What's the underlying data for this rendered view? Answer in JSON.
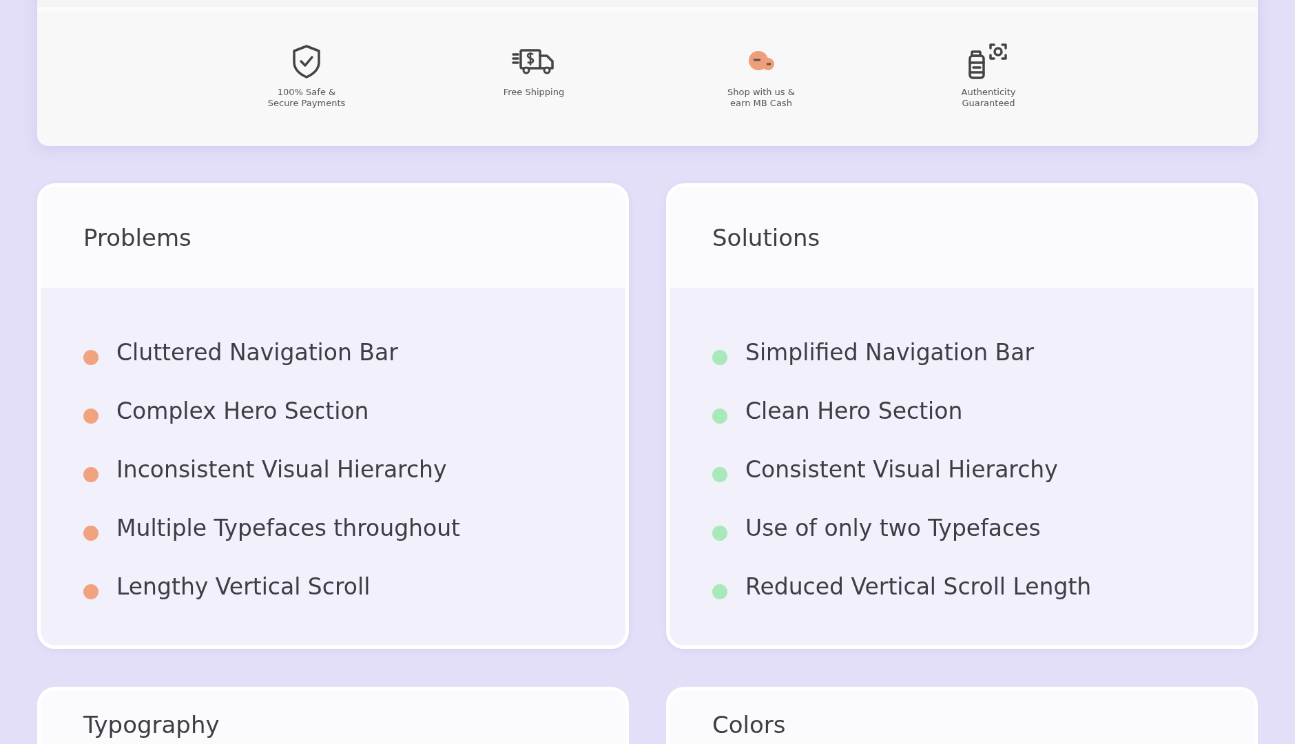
{
  "features": [
    {
      "label": "100% Safe &\nSecure Payments"
    },
    {
      "label": "Free Shipping"
    },
    {
      "label": "Shop with us &\nearn MB Cash"
    },
    {
      "label": "Authenticity\nGuaranteed"
    }
  ],
  "panels": [
    {
      "title": "Problems",
      "items": [
        {
          "text": "Cluttered Navigation Bar",
          "color": "#f0a37e"
        },
        {
          "text": "Complex Hero Section",
          "color": "#f0a37e"
        },
        {
          "text": "Inconsistent Visual Hierarchy",
          "color": "#f0a37e"
        },
        {
          "text": "Multiple Typefaces throughout",
          "color": "#f0a37e"
        },
        {
          "text": "Lengthy Vertical Scroll",
          "color": "#f0a37e"
        }
      ]
    },
    {
      "title": "Solutions",
      "items": [
        {
          "text": "Simplified Navigation Bar",
          "color": "#a9e8b8"
        },
        {
          "text": "Clean Hero Section",
          "color": "#a9e8b8"
        },
        {
          "text": "Consistent Visual Hierarchy",
          "color": "#a9e8b8"
        },
        {
          "text": "Use of only two Typefaces",
          "color": "#a9e8b8"
        },
        {
          "text": "Reduced Vertical Scroll Length",
          "color": "#a9e8b8"
        }
      ]
    },
    {
      "title": "Typography"
    },
    {
      "title": "Colors"
    }
  ]
}
